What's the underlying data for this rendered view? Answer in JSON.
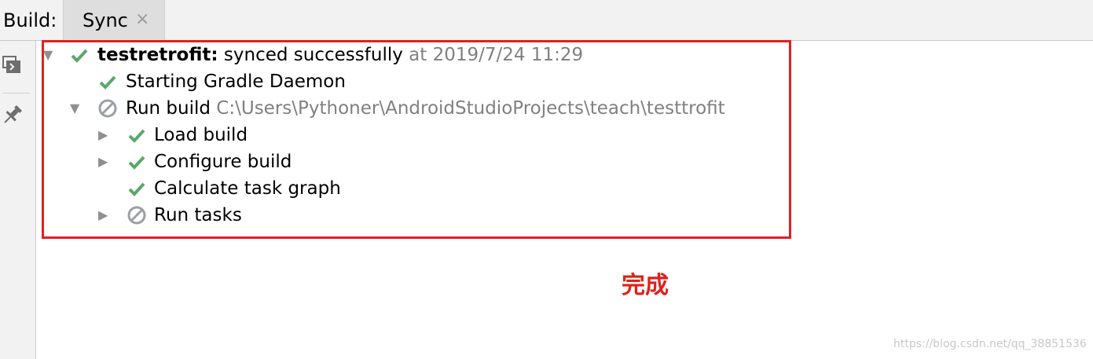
{
  "toolbar": {
    "label": "Build:",
    "tab": "Sync",
    "close_glyph": "×"
  },
  "sidebar": {
    "icons": [
      "console-restore-icon",
      "pin-icon"
    ]
  },
  "tree": {
    "root": {
      "name": "testretrofit:",
      "status": "synced successfully",
      "time": "at 2019/7/24 11:29"
    },
    "items": [
      {
        "label": "Starting Gradle Daemon"
      },
      {
        "label": "Run build",
        "path": "C:\\Users\\Pythoner\\AndroidStudioProjects\\teach\\testtrofit"
      },
      {
        "label": "Load build"
      },
      {
        "label": "Configure build"
      },
      {
        "label": "Calculate task graph"
      },
      {
        "label": "Run tasks"
      }
    ]
  },
  "annotation": "完成",
  "watermark": "https://blog.csdn.net/qq_38851536",
  "colors": {
    "success": "#59a869",
    "skipped": "#9aa0a6",
    "annotation": "#e0201b",
    "box": "#e02020"
  }
}
